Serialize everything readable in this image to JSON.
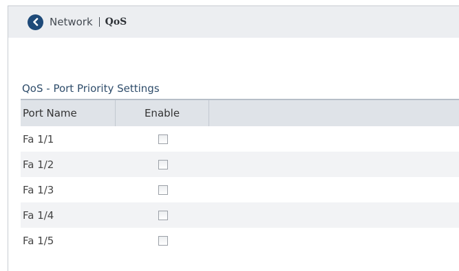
{
  "header": {
    "back_icon": "chevron-left-circle-icon",
    "breadcrumb_parent": "Network",
    "breadcrumb_current": "QoS"
  },
  "section": {
    "title": "QoS - Port Priority Settings"
  },
  "table": {
    "columns": [
      "Port Name",
      "Enable"
    ],
    "rows": [
      {
        "port": "Fa 1/1",
        "enabled": false
      },
      {
        "port": "Fa 1/2",
        "enabled": false
      },
      {
        "port": "Fa 1/3",
        "enabled": false
      },
      {
        "port": "Fa 1/4",
        "enabled": false
      },
      {
        "port": "Fa 1/5",
        "enabled": false
      }
    ]
  },
  "colors": {
    "accent": "#1e4a79",
    "header_bg": "#eceef1",
    "table_header_bg": "#dfe3e8",
    "row_alt_bg": "#f2f3f5"
  }
}
